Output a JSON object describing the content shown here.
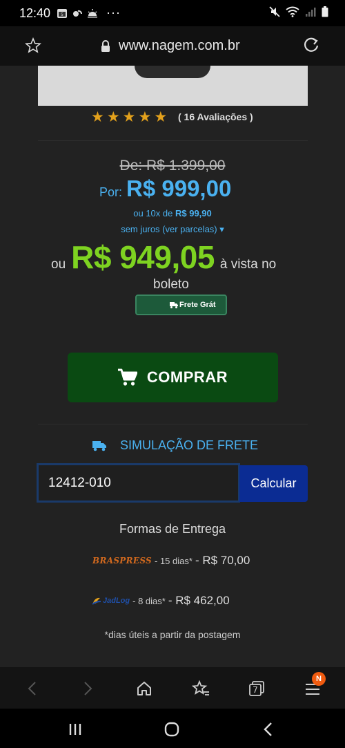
{
  "status_bar": {
    "time": "12:40",
    "dots": "···"
  },
  "url_bar": {
    "url": "www.nagem.com.br"
  },
  "product": {
    "rating_stars": 5,
    "reviews_label": "( 16 Avaliações )",
    "old_price": "De: R$ 1.399,00",
    "por_label": "Por:",
    "price": "R$ 999,00",
    "installments_prefix": "ou 10x de",
    "installments_value": "R$ 99,90",
    "parcelas_label": "sem juros (ver parcelas)",
    "cash_prefix": "ou",
    "cash_price": "R$ 949,05",
    "cash_suffix": "à vista no",
    "cash_boleto": "boleto",
    "frete_badge": "Frete Grát",
    "buy_label": "COMPRAR"
  },
  "shipping": {
    "sim_label": "SIMULAÇÃO DE FRETE",
    "cep_value": "12412-010",
    "calc_label": "Calcular",
    "formas_title": "Formas de Entrega",
    "options": [
      {
        "carrier": "BRASPRESS",
        "days": "- 15 dias*",
        "price": "- R$ 70,00"
      },
      {
        "carrier": "JadLog",
        "days": "- 8 dias*",
        "price": "- R$ 462,00"
      }
    ],
    "note": "*dias úteis a partir da postagem"
  },
  "toolbar": {
    "tab_count": "7",
    "notification_badge": "N"
  },
  "colors": {
    "accent_blue": "#4ab1f0",
    "cash_green": "#7ed321",
    "buy_button": "#0a4a12",
    "calc_button": "#0b2c93",
    "star": "#e3a11c",
    "badge_orange": "#f05b10"
  }
}
